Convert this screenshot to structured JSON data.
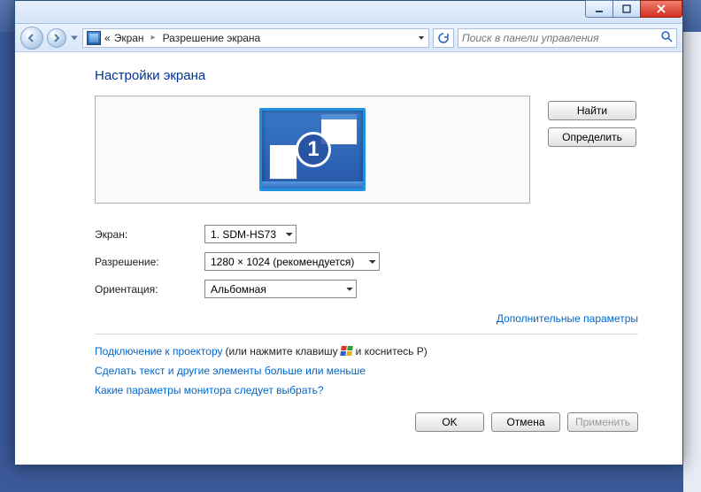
{
  "breadcrumb": {
    "pre": "«",
    "item1": "Экран",
    "item2": "Разрешение экрана"
  },
  "search": {
    "placeholder": "Поиск в панели управления"
  },
  "heading": "Настройки экрана",
  "monitor_number": "1",
  "side": {
    "find": "Найти",
    "detect": "Определить"
  },
  "labels": {
    "display": "Экран:",
    "resolution": "Разрешение:",
    "orientation": "Ориентация:"
  },
  "values": {
    "display": "1. SDM-HS73",
    "resolution": "1280 × 1024 (рекомендуется)",
    "orientation": "Альбомная"
  },
  "advanced": "Дополнительные параметры",
  "help": {
    "projector_link": "Подключение к проектору",
    "projector_suffix_a": "(или нажмите клавишу",
    "projector_suffix_b": "и коснитесь P)",
    "textsize": "Сделать текст и другие элементы больше или меньше",
    "which": "Какие параметры монитора следует выбрать?"
  },
  "footer": {
    "ok": "OK",
    "cancel": "Отмена",
    "apply": "Применить"
  }
}
